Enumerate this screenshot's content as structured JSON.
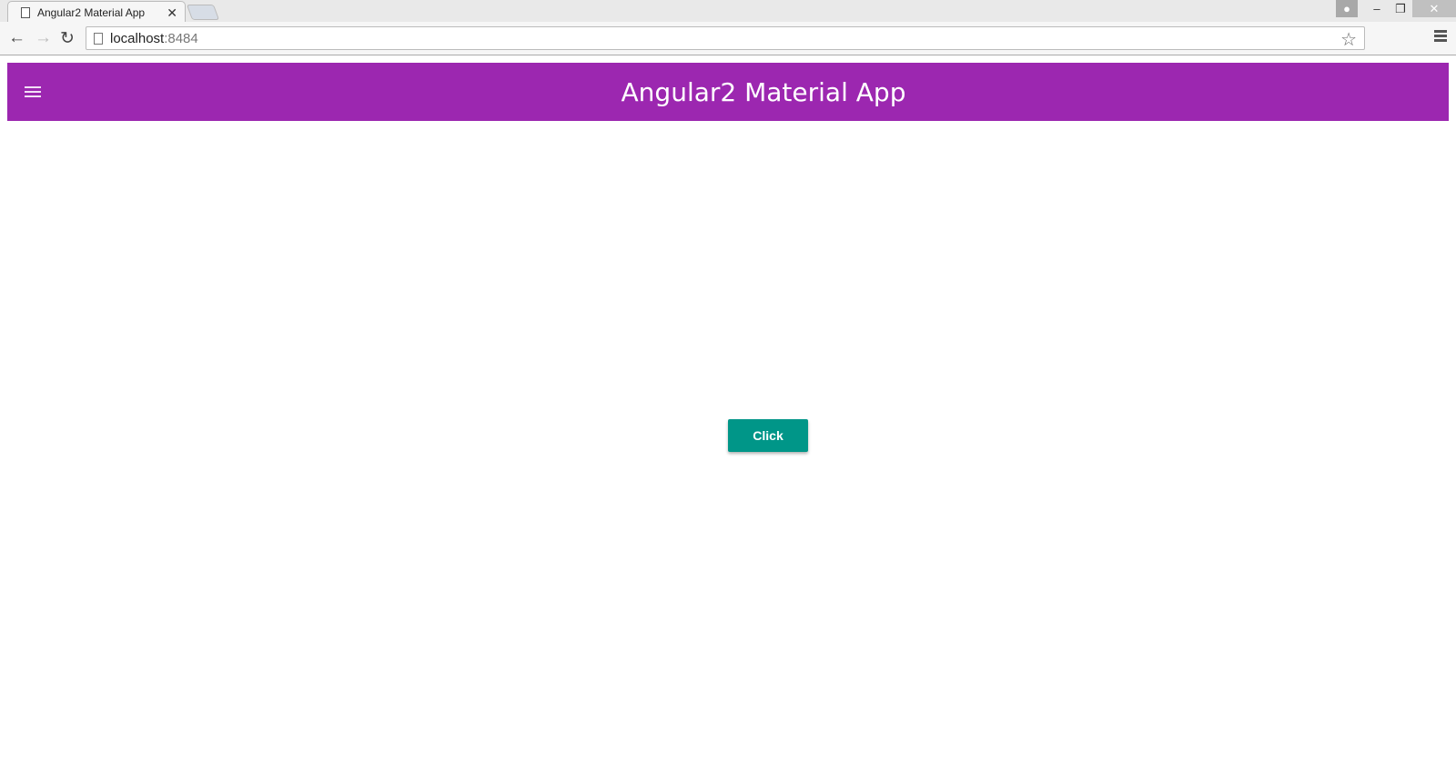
{
  "browser": {
    "tab_title": "Angular2 Material App",
    "url_host": "localhost",
    "url_port": ":8484"
  },
  "app": {
    "title": "Angular2 Material App",
    "primary_color": "#9c27b0",
    "accent_color": "#009688"
  },
  "main": {
    "button_label": "Click"
  }
}
